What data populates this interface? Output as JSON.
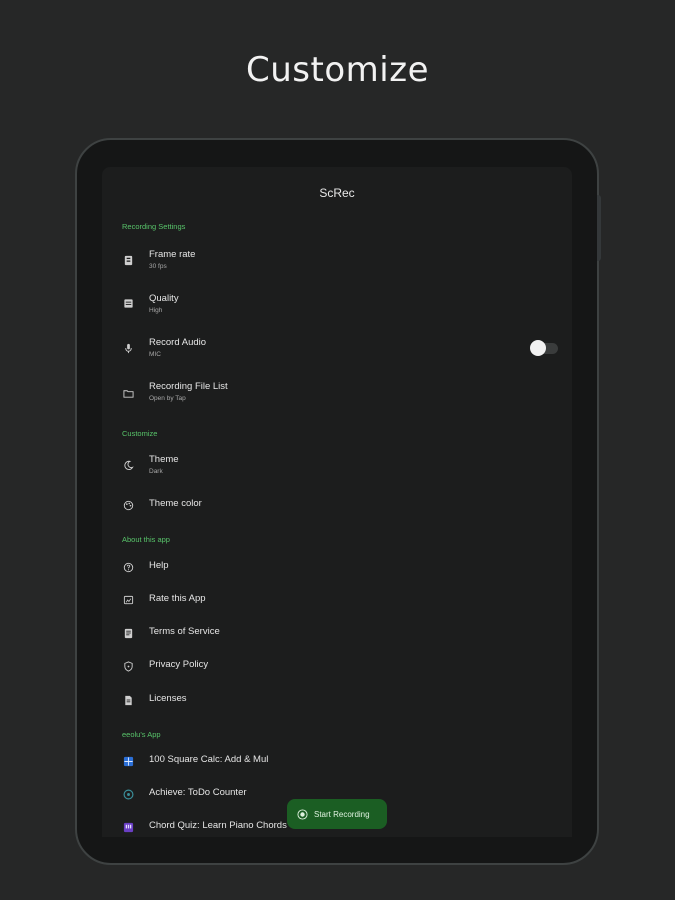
{
  "headline": "Customize",
  "app": {
    "title": "ScRec"
  },
  "sections": {
    "recording": {
      "header": "Recording Settings",
      "frame_rate": {
        "title": "Frame rate",
        "subtitle": "30 fps"
      },
      "quality": {
        "title": "Quality",
        "subtitle": "High"
      },
      "record_audio": {
        "title": "Record Audio",
        "subtitle": "MIC",
        "toggle_on": false
      },
      "file_list": {
        "title": "Recording File List",
        "subtitle": "Open by Tap"
      }
    },
    "customize": {
      "header": "Customize",
      "theme": {
        "title": "Theme",
        "subtitle": "Dark"
      },
      "theme_color": {
        "title": "Theme color"
      }
    },
    "about": {
      "header": "About this app",
      "help": "Help",
      "rate": "Rate this App",
      "terms": "Terms of Service",
      "privacy": "Privacy Policy",
      "licenses": "Licenses"
    },
    "apps": {
      "header": "eeolu's App",
      "app1": "100 Square Calc: Add & Mul",
      "app2": "Achieve: ToDo Counter",
      "app3": "Chord Quiz: Learn Piano Chords"
    }
  },
  "fab": {
    "label": "Start Recording"
  },
  "colors": {
    "accent_green": "#58c46a",
    "fab_green": "#1b5e23",
    "background": "#262727"
  }
}
